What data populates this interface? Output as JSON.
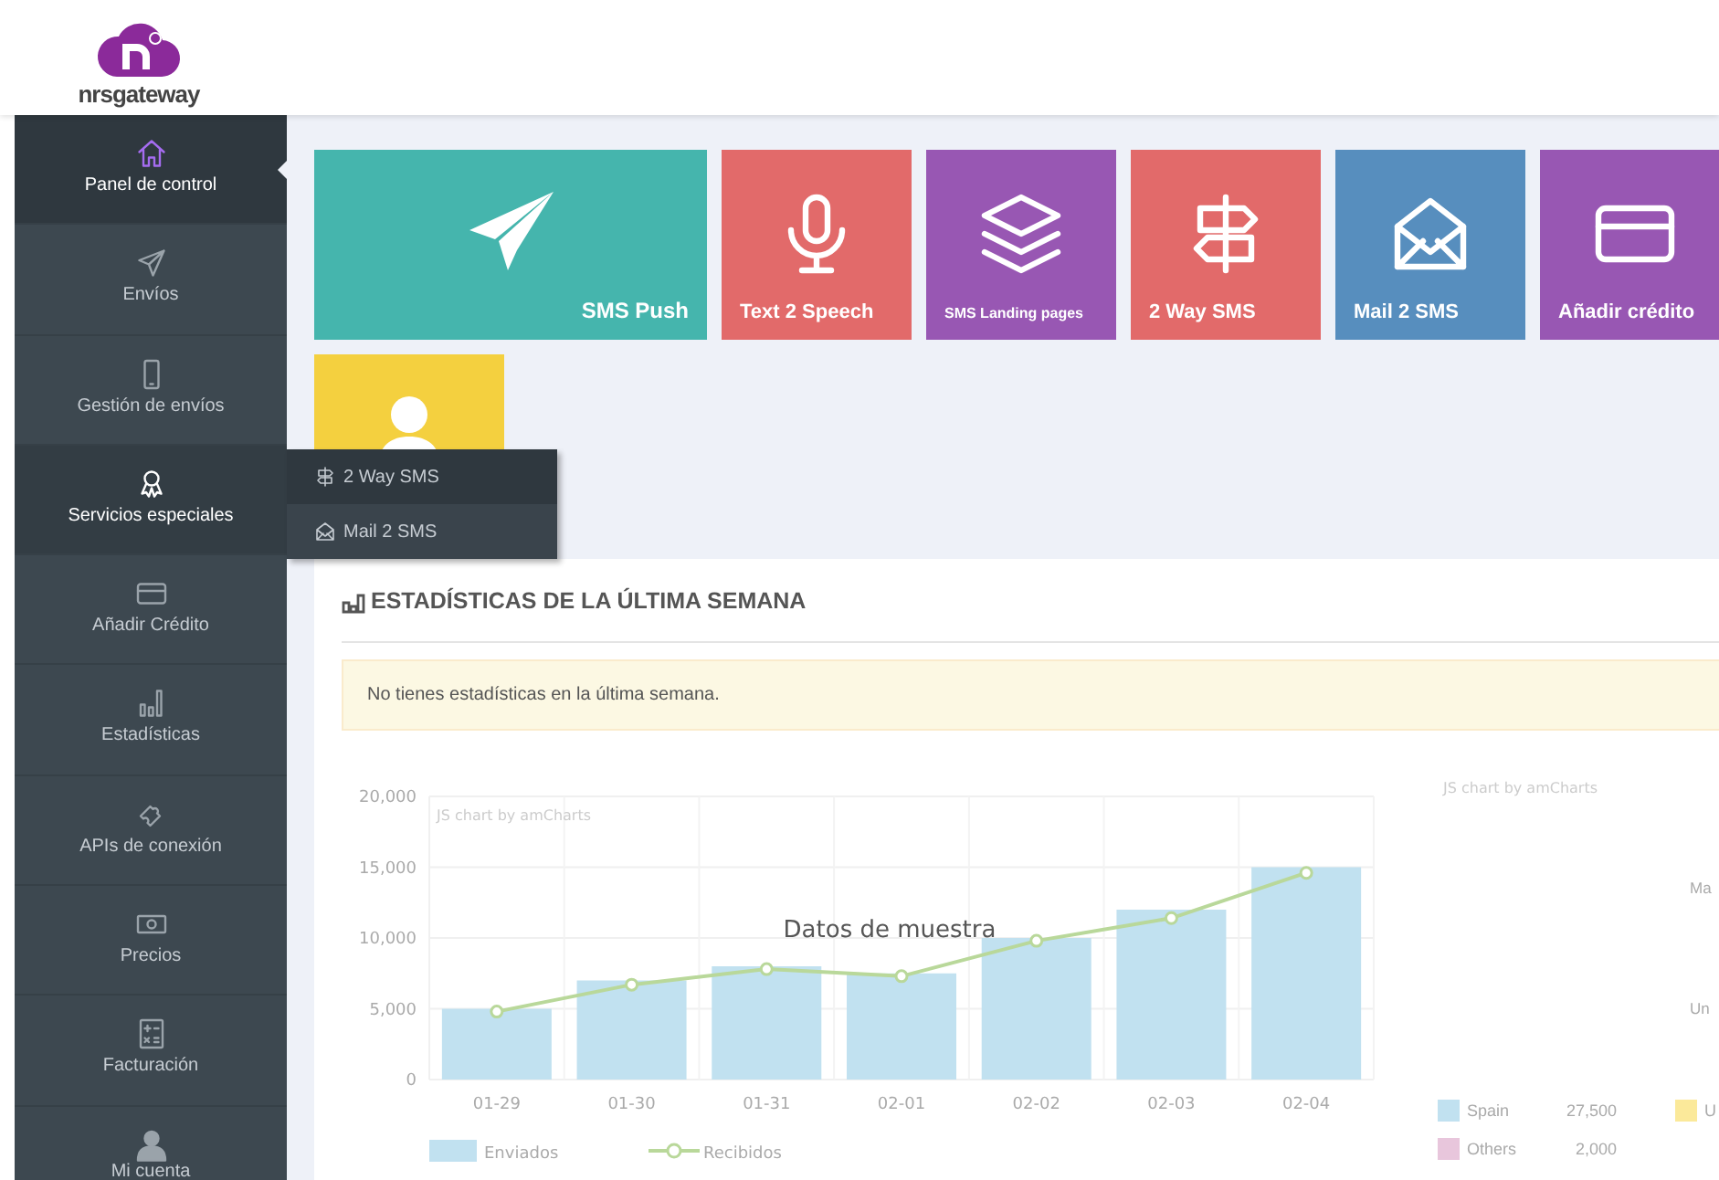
{
  "logo": {
    "text": "nrsgateway"
  },
  "sidebar": {
    "items": [
      {
        "label": "Panel de control",
        "selected": true,
        "expanded": false
      },
      {
        "label": "Envíos",
        "selected": false,
        "expanded": false
      },
      {
        "label": "Gestión de envíos",
        "selected": false,
        "expanded": false
      },
      {
        "label": "Servicios especiales",
        "selected": false,
        "expanded": true
      },
      {
        "label": "Añadir Crédito",
        "selected": false,
        "expanded": false
      },
      {
        "label": "Estadísticas",
        "selected": false,
        "expanded": false
      },
      {
        "label": "APIs de conexión",
        "selected": false,
        "expanded": false
      },
      {
        "label": "Precios",
        "selected": false,
        "expanded": false
      },
      {
        "label": "Facturación",
        "selected": false,
        "expanded": false
      },
      {
        "label": "Mi cuenta",
        "selected": false,
        "expanded": false
      }
    ]
  },
  "submenu": {
    "items": [
      {
        "label": "2 Way SMS",
        "selected": false
      },
      {
        "label": "Mail 2 SMS",
        "selected": true
      }
    ]
  },
  "tiles": [
    {
      "label": "SMS Push",
      "kind": "wide",
      "color": "#45b5ad"
    },
    {
      "label": "Text 2 Speech",
      "kind": "normal",
      "color": "#e26a6a"
    },
    {
      "label": "SMS Landing pages",
      "kind": "small",
      "color": "#9857b3"
    },
    {
      "label": "2 Way SMS",
      "kind": "normal",
      "color": "#e26a6a"
    },
    {
      "label": "Mail 2 SMS",
      "kind": "normal",
      "color": "#578ebe"
    },
    {
      "label": "Añadir crédito",
      "kind": "normal",
      "color": "#9857b3"
    },
    {
      "kind": "icon-only",
      "color": "#f4d03f"
    }
  ],
  "stats": {
    "title": "ESTADÍSTICAS DE LA ÚLTIMA SEMANA",
    "alert": "No tienes estadísticas en la última semana.",
    "chart_data": {
      "type": "bar",
      "title": "Datos de muestra",
      "categories": [
        "01-29",
        "01-30",
        "01-31",
        "02-01",
        "02-02",
        "02-03",
        "02-04"
      ],
      "series": [
        {
          "name": "Enviados",
          "type": "bar",
          "color": "#c1e1f0",
          "values": [
            5000,
            7000,
            8000,
            7500,
            10000,
            12000,
            15000
          ]
        },
        {
          "name": "Recibidos",
          "type": "line",
          "marker": "circle",
          "color": "#b9d89a",
          "values": [
            4800,
            6700,
            7800,
            7300,
            9800,
            11400,
            14600
          ]
        }
      ],
      "grid": true,
      "legend": true,
      "ylim": [
        0,
        20000
      ],
      "yticks": [
        {
          "value": 0,
          "label": "0"
        },
        {
          "value": 5000,
          "label": "5,000"
        },
        {
          "value": 10000,
          "label": "10,000"
        },
        {
          "value": 15000,
          "label": "15,000"
        },
        {
          "value": 20000,
          "label": "20,000"
        }
      ],
      "annotations": [
        "JS chart by amCharts"
      ]
    },
    "side_chart": {
      "credit": "JS chart by amCharts",
      "labels": [
        "Ma",
        "Un"
      ],
      "legend": [
        {
          "name": "Spain",
          "value": "27,500",
          "color": "#c1e1f0"
        },
        {
          "name": "U",
          "color": "#fbe99a"
        },
        {
          "name": "Others",
          "value": "2,000",
          "color": "#e8c6dc"
        }
      ]
    }
  }
}
